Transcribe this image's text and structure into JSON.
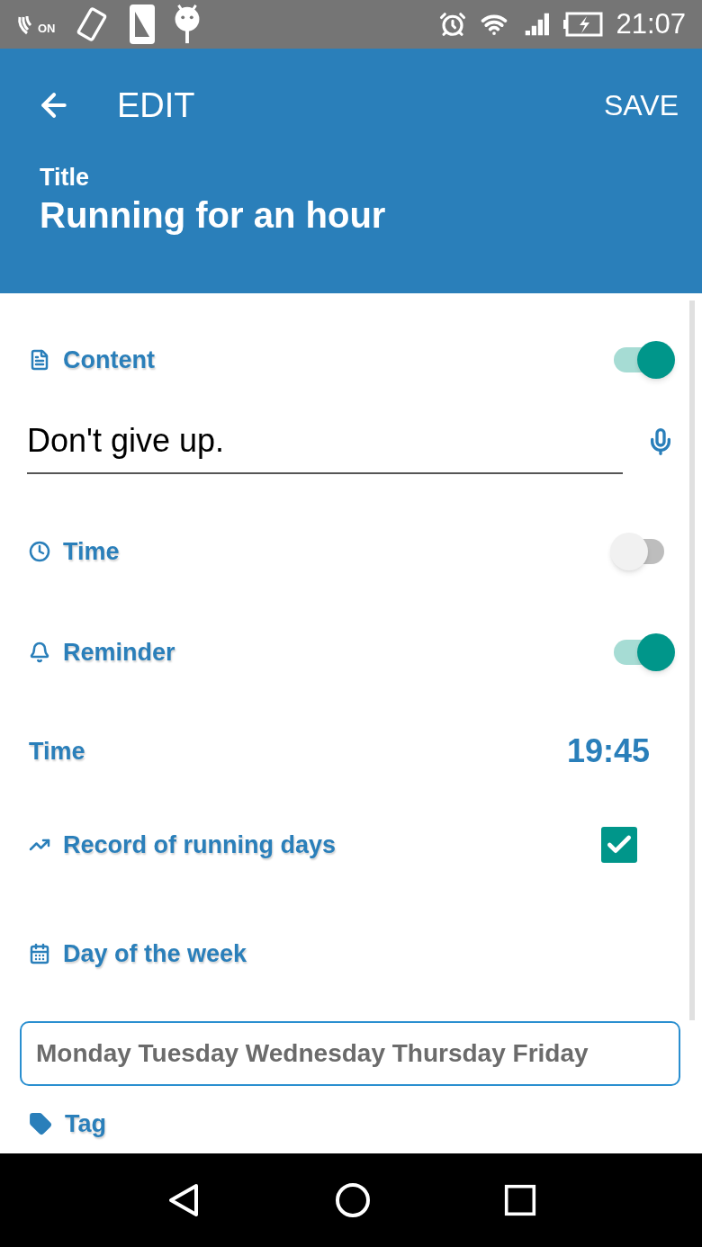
{
  "status_bar": {
    "on_badge": "ON",
    "time": "21:07"
  },
  "app_bar": {
    "title": "EDIT",
    "action": "SAVE"
  },
  "header": {
    "label": "Title",
    "value": "Running for an hour"
  },
  "content": {
    "label": "Content",
    "on": true,
    "value": "Don't give up."
  },
  "time": {
    "label": "Time",
    "on": false
  },
  "reminder": {
    "label": "Reminder",
    "on": true
  },
  "reminder_time": {
    "label": "Time",
    "value": "19:45"
  },
  "record": {
    "label": "Record of running days",
    "checked": true
  },
  "day_of_week": {
    "label": "Day of the week",
    "value": "Monday Tuesday Wednesday Thursday Friday"
  },
  "tag": {
    "label": "Tag"
  }
}
